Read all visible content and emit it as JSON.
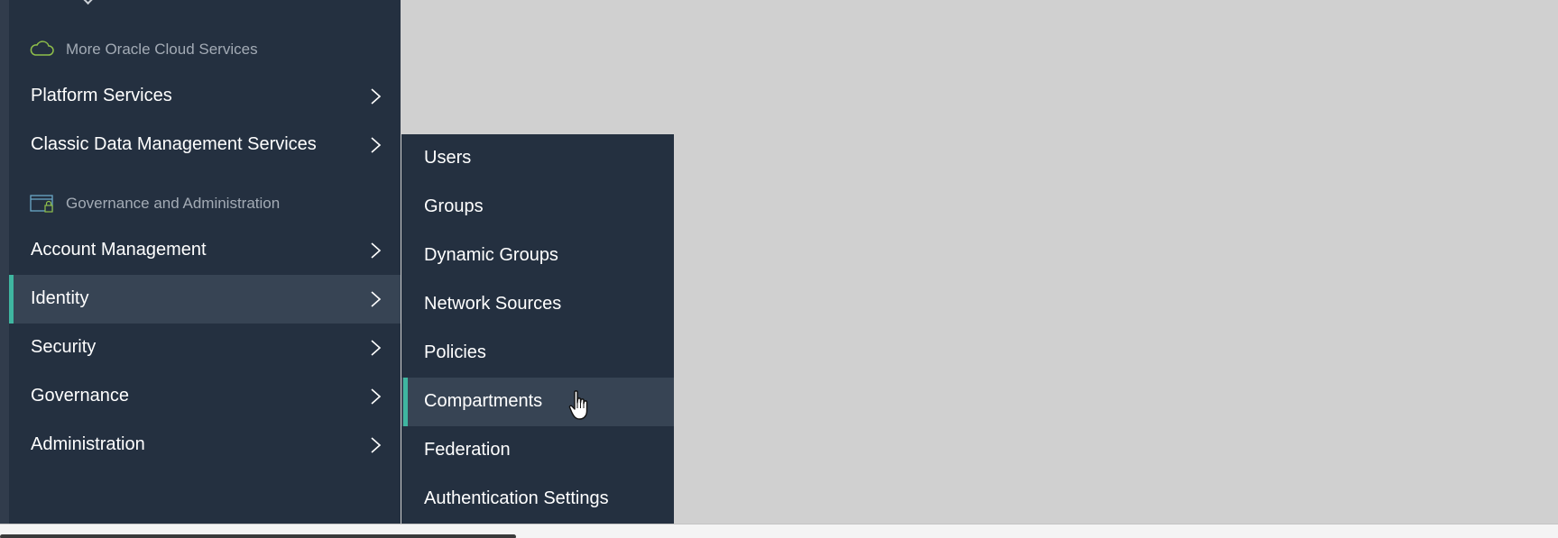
{
  "sections": [
    {
      "label": "More Oracle Cloud Services",
      "icon": "cloud-icon"
    },
    {
      "label": "Governance and Administration",
      "icon": "admin-window-lock-icon"
    }
  ],
  "nav": {
    "items": [
      {
        "label": "Platform Services"
      },
      {
        "label": "Classic Data Management Services"
      },
      {
        "label": "Account Management"
      },
      {
        "label": "Identity",
        "active": true
      },
      {
        "label": "Security"
      },
      {
        "label": "Governance"
      },
      {
        "label": "Administration"
      }
    ]
  },
  "submenu": {
    "items": [
      {
        "label": "Users"
      },
      {
        "label": "Groups"
      },
      {
        "label": "Dynamic Groups"
      },
      {
        "label": "Network Sources"
      },
      {
        "label": "Policies"
      },
      {
        "label": "Compartments",
        "active": true
      },
      {
        "label": "Federation"
      },
      {
        "label": "Authentication Settings"
      }
    ]
  },
  "colors": {
    "panel": "#243040",
    "active_row": "#374454",
    "accent": "#3fb6a0",
    "section_text": "#a3abb5",
    "backdrop": "#d0d0d0"
  }
}
